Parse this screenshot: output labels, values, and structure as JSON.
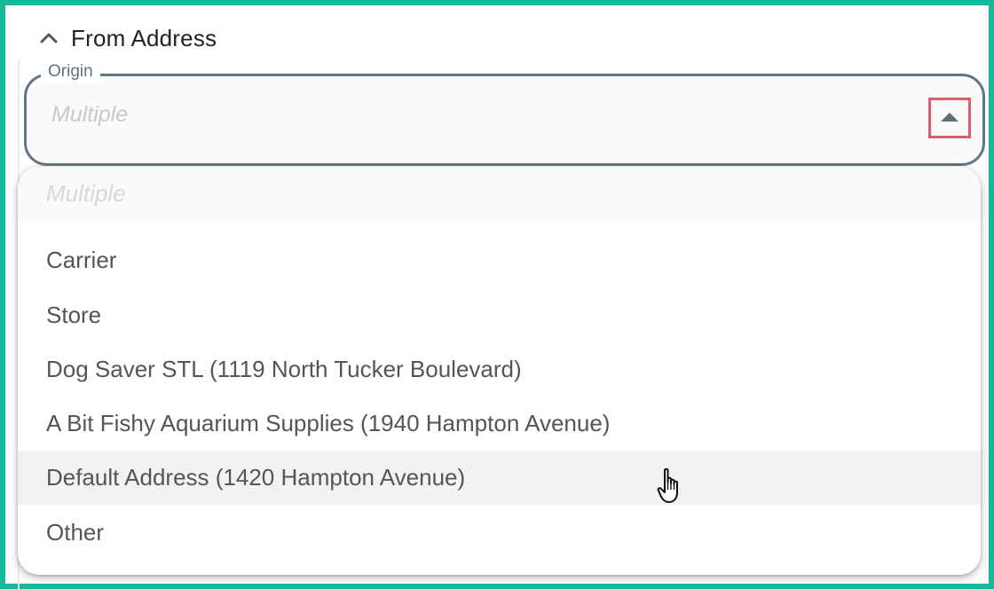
{
  "section": {
    "title": "From Address"
  },
  "origin_field": {
    "label": "Origin",
    "value": "Multiple"
  },
  "dropdown": {
    "options": [
      {
        "label": "Multiple",
        "placeholder": true
      },
      {
        "label": "Carrier"
      },
      {
        "label": "Store"
      },
      {
        "label": "Dog Saver STL (1119 North Tucker Boulevard)"
      },
      {
        "label": "A Bit Fishy Aquarium Supplies (1940 Hampton Avenue)"
      },
      {
        "label": "Default Address (1420 Hampton Avenue)",
        "hovered": true
      },
      {
        "label": "Other"
      }
    ]
  },
  "colors": {
    "frame_border": "#16b89a",
    "field_border": "#627783",
    "highlight_box": "#d9606a",
    "hover_row": "#f2f2f2"
  },
  "icons": {
    "collapse": "chevron-up-icon",
    "dropdown_toggle": "caret-up-icon",
    "pointer": "hand-cursor-icon"
  }
}
